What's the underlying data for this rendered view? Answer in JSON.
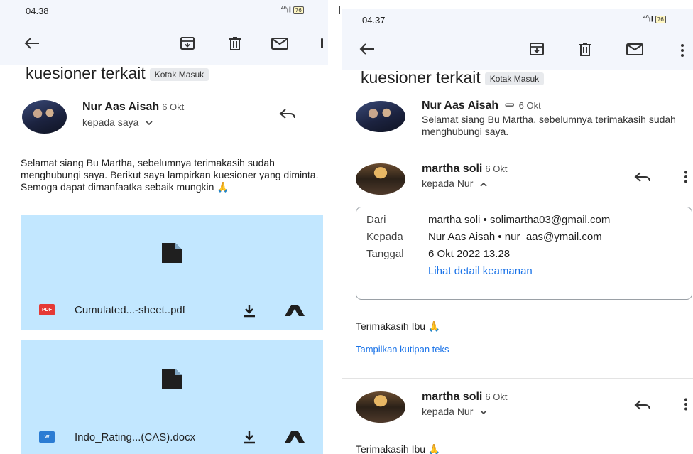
{
  "left": {
    "status": {
      "time": "04.38",
      "signal": "46",
      "battery": "76"
    },
    "subject": "kuesioner terkait",
    "label": "Kotak Masuk",
    "message": {
      "sender": "Nur Aas Aisah",
      "date": "6 Okt",
      "recipient": "kepada saya",
      "body": "Selamat siang Bu Martha, sebelumnya terimakasih sudah menghubungi saya. Berikut saya lampirkan kuesioner yang diminta. Semoga dapat dimanfaatka sebaik mungkin 🙏"
    },
    "attachments": [
      {
        "type": "PDF",
        "name": "Cumulated...-sheet..pdf",
        "badge_color": "#e53935"
      },
      {
        "type": "W",
        "name": "Indo_Rating...(CAS).docx",
        "badge_color": "#2b7cd3"
      }
    ]
  },
  "right": {
    "status": {
      "time": "04.37",
      "signal": "46",
      "battery": "76"
    },
    "subject": "kuesioner terkait",
    "label": "Kotak Masuk",
    "message1": {
      "sender": "Nur Aas Aisah",
      "date": "6 Okt",
      "snippet": "Selamat siang Bu Martha, sebelumnya terimakasih sudah menghubungi saya."
    },
    "message2": {
      "sender": "martha soli",
      "date": "6 Okt",
      "recipient": "kepada Nur",
      "details": {
        "from_label": "Dari",
        "from_value": "martha soli • solimartha03@gmail.com",
        "to_label": "Kepada",
        "to_value": "Nur Aas Aisah • nur_aas@ymail.com",
        "date_label": "Tanggal",
        "date_value": "6 Okt 2022 13.28",
        "security_link": "Lihat detail keamanan"
      },
      "body": "Terimakasih Ibu 🙏",
      "show_quoted": "Tampilkan kutipan teks"
    },
    "message3": {
      "sender": "martha soli",
      "date": "6 Okt",
      "recipient": "kepada Nur",
      "body": "Terimakasih Ibu 🙏"
    }
  }
}
